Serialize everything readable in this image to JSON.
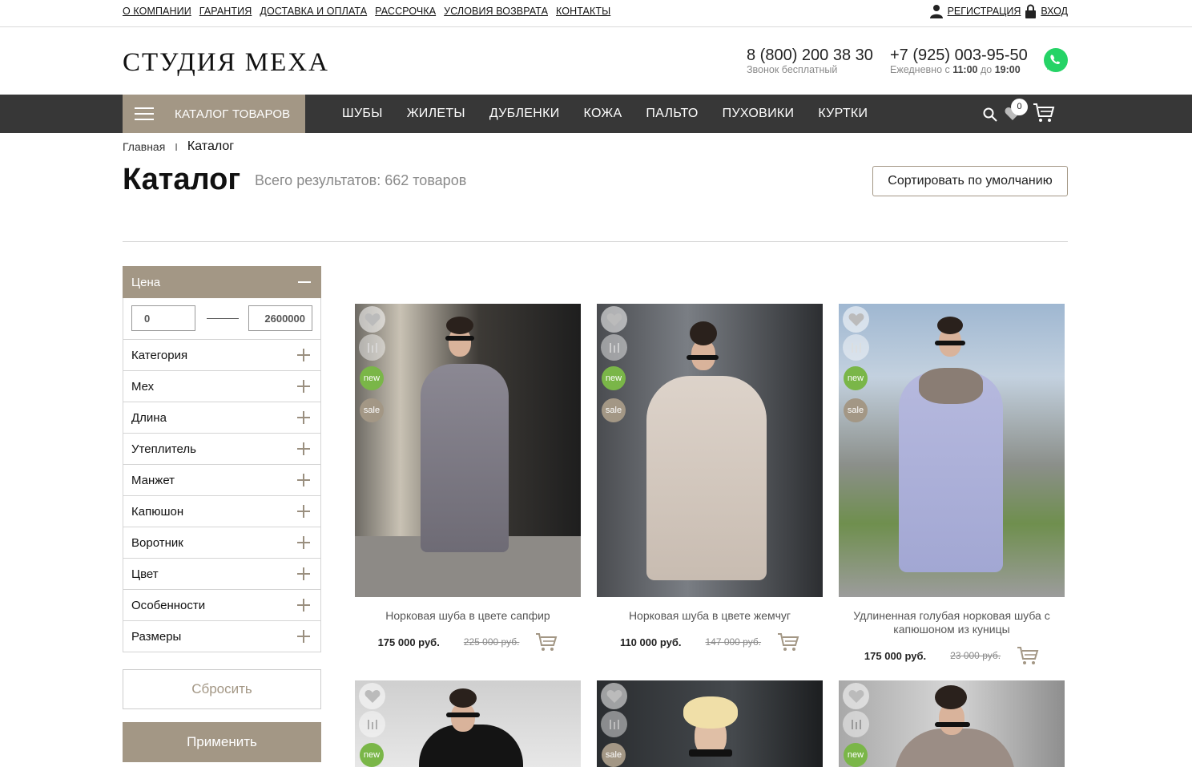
{
  "top_links": [
    "О КОМПАНИИ",
    "ГАРАНТИЯ",
    "ДОСТАВКА И ОПЛАТА",
    "РАССРОЧКА",
    "УСЛОВИЯ ВОЗВРАТА",
    "КОНТАКТЫ"
  ],
  "auth": {
    "register": "РЕГИСТРАЦИЯ",
    "login": "ВХОД"
  },
  "logo": "СТУДИЯ МЕХА",
  "phones": [
    {
      "number": "8 (800) 200 38 30",
      "note": "Звонок бесплатный"
    },
    {
      "number": "+7 (925) 003-95-50",
      "note_prefix": "Ежедневно с ",
      "from": "11:00",
      "mid": " до ",
      "to": "19:00"
    }
  ],
  "nav": {
    "catalog_button": "КАТАЛОГ ТОВАРОВ",
    "links": [
      "ШУБЫ",
      "ЖИЛЕТЫ",
      "ДУБЛЕНКИ",
      "КОЖА",
      "ПАЛЬТО",
      "ПУХОВИКИ",
      "КУРТКИ"
    ],
    "favorites_count": "0"
  },
  "breadcrumbs": {
    "home": "Главная",
    "separator": "I",
    "current": "Каталог"
  },
  "page_title": "Каталог",
  "results_text": "Всего результатов: 662 товаров",
  "sort_label": "Сортировать по умолчанию",
  "filter": {
    "price_label": "Цена",
    "price_from": "0",
    "price_to": "2600000",
    "sections": [
      "Категория",
      "Мех",
      "Длина",
      "Утеплитель",
      "Манжет",
      "Капюшон",
      "Воротник",
      "Цвет",
      "Особенности",
      "Размеры"
    ],
    "reset_label": "Сбросить",
    "apply_label": "Применить"
  },
  "badges": {
    "new": "new",
    "sale": "sale"
  },
  "colors": {
    "accent": "#a39785",
    "nav_bg": "#373737",
    "badge_new": "#7ab648",
    "whatsapp": "#25d366"
  },
  "products": [
    {
      "name": "Норковая шуба в цвете сапфир",
      "price": "175 000 руб.",
      "old_price": "225 000 руб.",
      "is_new": true,
      "is_sale": true
    },
    {
      "name": "Норковая шуба в цвете жемчуг",
      "price": "110 000 руб.",
      "old_price": "147 000 руб.",
      "is_new": true,
      "is_sale": true
    },
    {
      "name": "Удлиненная голубая норковая шуба с капюшоном из куницы",
      "price": "175 000 руб.",
      "old_price": "23 000 руб.",
      "is_new": true,
      "is_sale": true
    },
    {
      "name": "",
      "is_new": true,
      "is_sale": false
    },
    {
      "name": "",
      "is_new": false,
      "is_sale": true
    },
    {
      "name": "",
      "is_new": true,
      "is_sale": false
    }
  ]
}
